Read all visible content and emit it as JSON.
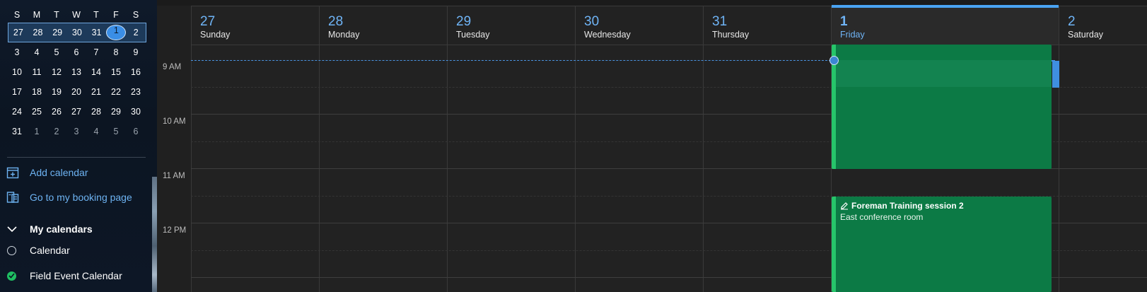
{
  "mini_calendar": {
    "days_of_week": [
      "S",
      "M",
      "T",
      "W",
      "T",
      "F",
      "S"
    ],
    "weeks": [
      [
        "27",
        "28",
        "29",
        "30",
        "31",
        "1",
        "2"
      ],
      [
        "3",
        "4",
        "5",
        "6",
        "7",
        "8",
        "9"
      ],
      [
        "10",
        "11",
        "12",
        "13",
        "14",
        "15",
        "16"
      ],
      [
        "17",
        "18",
        "19",
        "20",
        "21",
        "22",
        "23"
      ],
      [
        "24",
        "25",
        "26",
        "27",
        "28",
        "29",
        "30"
      ],
      [
        "31",
        "1",
        "2",
        "3",
        "4",
        "5",
        "6"
      ]
    ]
  },
  "sidebar": {
    "add_calendar": "Add calendar",
    "booking_page": "Go to my booking page",
    "my_calendars": "My calendars",
    "calendars": [
      {
        "label": "Calendar",
        "checked": false
      },
      {
        "label": "Field Event Calendar",
        "checked": true
      }
    ]
  },
  "week_header": [
    {
      "num": "27",
      "name": "Sunday"
    },
    {
      "num": "28",
      "name": "Monday"
    },
    {
      "num": "29",
      "name": "Tuesday"
    },
    {
      "num": "30",
      "name": "Wednesday"
    },
    {
      "num": "31",
      "name": "Thursday"
    },
    {
      "num": "1",
      "name": "Friday"
    },
    {
      "num": "2",
      "name": "Saturday"
    }
  ],
  "time_labels": [
    "9 AM",
    "10 AM",
    "11 AM",
    "12 PM"
  ],
  "events": [
    {
      "title": "Foreman Training session 2",
      "location": "East conference room"
    }
  ],
  "colors": {
    "accent": "#4aa3f2",
    "event_green": "#0c7a45",
    "event_border": "#26c56a"
  }
}
